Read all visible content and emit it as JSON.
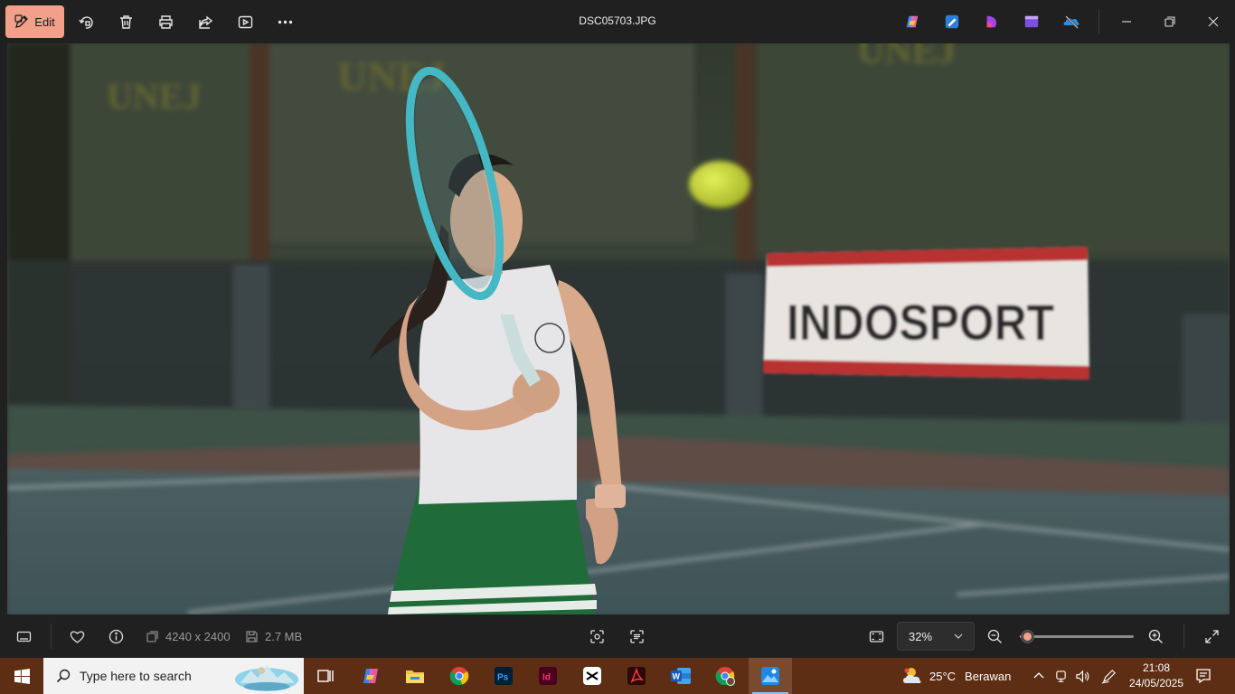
{
  "toolbar": {
    "edit_label": "Edit",
    "file_name": "DSC05703.JPG"
  },
  "photo": {
    "banner_text": "INDOSPORT",
    "curtain_text": "UNEJ"
  },
  "bottombar": {
    "dimensions": "4240 x 2400",
    "file_size": "2.7 MB",
    "zoom_value": "32%",
    "zoom_level_fraction": 0.06
  },
  "taskbar": {
    "search_placeholder": "Type here to search",
    "weather_temp": "25°C",
    "weather_desc": "Berawan",
    "time": "21:08",
    "date": "24/05/2025"
  },
  "colors": {
    "accent": "#f2a08a",
    "taskbar": "#5e2e14",
    "chrome": "#202020"
  }
}
